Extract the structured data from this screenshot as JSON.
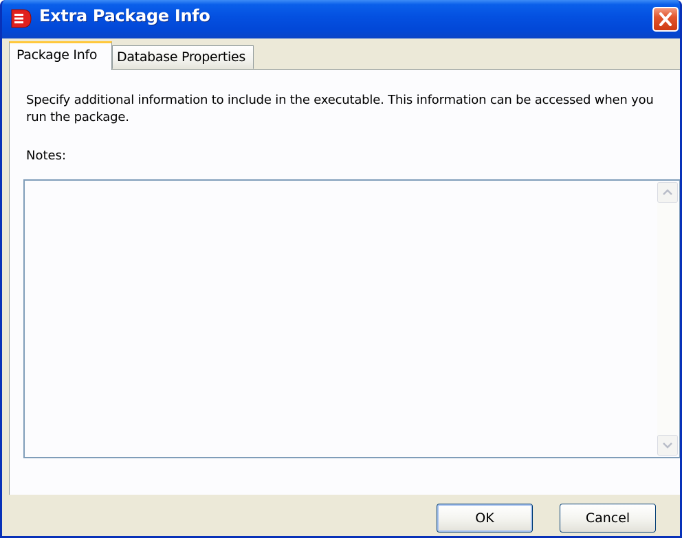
{
  "window": {
    "title": "Extra Package Info"
  },
  "tabs": [
    {
      "label": "Package Info",
      "active": true
    },
    {
      "label": "Database Properties",
      "active": false
    }
  ],
  "panel": {
    "description": "Specify additional information to include in the executable. This information can be accessed when you run the package.",
    "notes_label": "Notes:",
    "notes_value": ""
  },
  "buttons": {
    "ok_label": "OK",
    "cancel_label": "Cancel"
  },
  "icons": {
    "app": "package-app-icon",
    "close": "close-icon",
    "scroll_up": "chevron-up-icon",
    "scroll_down": "chevron-down-icon"
  },
  "colors": {
    "titlebar": "#0450e0",
    "close_button": "#e2552d",
    "dialog_face": "#ece9d8",
    "active_tab_accent": "#ffc83c",
    "textbox_border": "#7f9db9"
  }
}
